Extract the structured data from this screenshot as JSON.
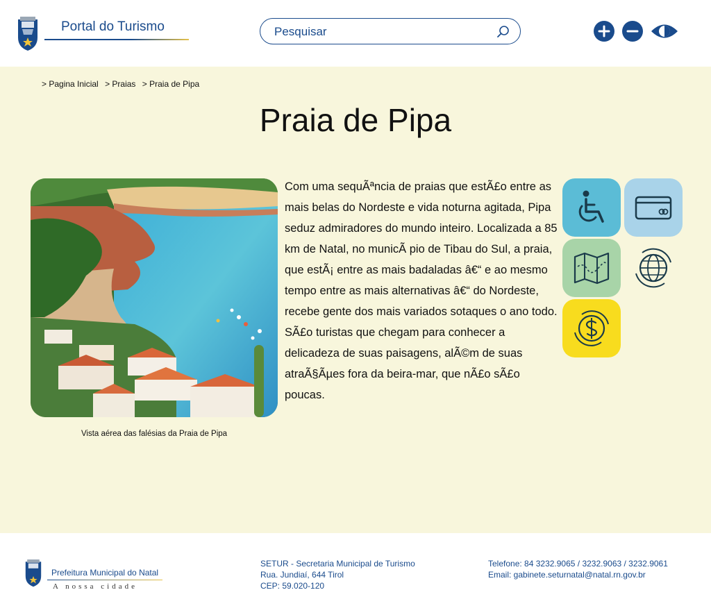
{
  "header": {
    "logo_title": "Portal do Turismo",
    "search_placeholder": "Pesquisar",
    "brand_color": "#1a4b8c"
  },
  "accessibility": {
    "increase_font_icon": "plus-circle-icon",
    "decrease_font_icon": "minus-circle-icon",
    "contrast_icon": "contrast-eye-icon"
  },
  "breadcrumb": [
    "> Pagina Inicial",
    "> Praias",
    "> Praia de Pipa"
  ],
  "page": {
    "title": "Praia de Pipa",
    "image_caption": "Vista aérea das falésias da Praia de Pipa",
    "description": "Com uma sequÃªncia de praias que estÃ£o entre as mais belas do Nordeste e vida noturna agitada, Pipa seduz admiradores do mundo inteiro. Localizada a 85 km de Natal, no municÃ pio de Tibau do Sul, a praia, que estÃ¡ entre as mais badaladas â€“ e ao mesmo tempo entre as mais alternativas â€“ do Nordeste, recebe gente dos mais variados sotaques o ano todo. SÃ£o turistas que chegam para conhecer a delicadeza de suas paisagens, alÃ©m de suas atraÃ§Ãµes fora da beira-mar, que nÃ£o sÃ£o poucas."
  },
  "feature_tiles": [
    {
      "icon": "wheelchair-icon",
      "color": "#5bbcd6"
    },
    {
      "icon": "credit-card-icon",
      "color": "#a9d3e9"
    },
    {
      "icon": "map-icon",
      "color": "#a8d4a8"
    },
    {
      "icon": "globe-icon",
      "color": "#f8f6dc"
    },
    {
      "icon": "money-icon",
      "color": "#f8dc1e"
    }
  ],
  "footer": {
    "logo_title": "Prefeitura Municipal do Natal",
    "logo_tagline": "A nossa cidade",
    "address": [
      "SETUR - Secretaria Municipal de Turismo",
      "Rua. Jundiaí, 644 Tirol",
      "CEP: 59.020-120"
    ],
    "contact": [
      "Telefone: 84 3232.9065 / 3232.9063 / 3232.9061",
      "Email: gabinete.seturnatal@natal.rn.gov.br"
    ]
  },
  "colors": {
    "background_main": "#f8f6dc",
    "footer_text": "#1a4b8c"
  }
}
